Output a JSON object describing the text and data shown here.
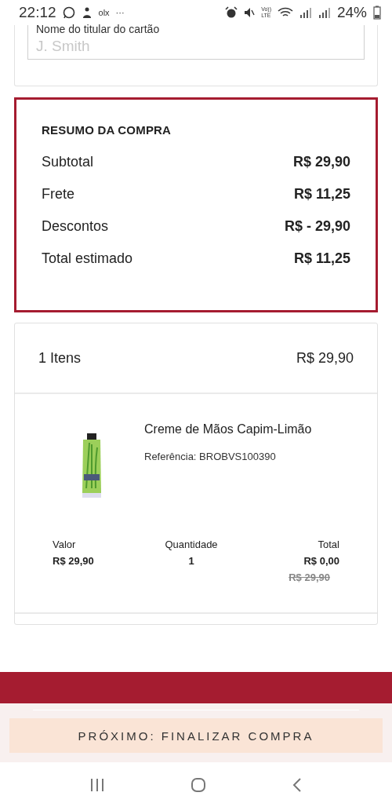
{
  "status_bar": {
    "time": "22:12",
    "app_label": "olx",
    "more": "···",
    "volte": [
      "Vo))",
      "LTE"
    ],
    "battery": "24%"
  },
  "card_holder": {
    "label": "Nome do titular do cartão",
    "placeholder": "J. Smith"
  },
  "summary": {
    "title": "RESUMO DA COMPRA",
    "rows": [
      {
        "label": "Subtotal",
        "value": "R$ 29,90"
      },
      {
        "label": "Frete",
        "value": "R$ 11,25"
      },
      {
        "label": "Descontos",
        "value": "R$ - 29,90"
      },
      {
        "label": "Total estimado",
        "value": "R$ 11,25"
      }
    ]
  },
  "cart": {
    "count": "1 Itens",
    "total": "R$ 29,90",
    "items": [
      {
        "image": {
          "kind": "picture"
        },
        "name": "Creme de Mãos Capim-Limão",
        "reference": "Referência: BROBVS100390",
        "columns": [
          {
            "label": "Valor",
            "value": "R$ 29,90"
          },
          {
            "label": "Quantidade",
            "value": "1"
          },
          {
            "label": "Total",
            "value": "R$ 0,00",
            "old_value": "R$ 29,90"
          }
        ]
      }
    ]
  },
  "next_button": "PRÓXIMO: FINALIZAR COMPRA"
}
